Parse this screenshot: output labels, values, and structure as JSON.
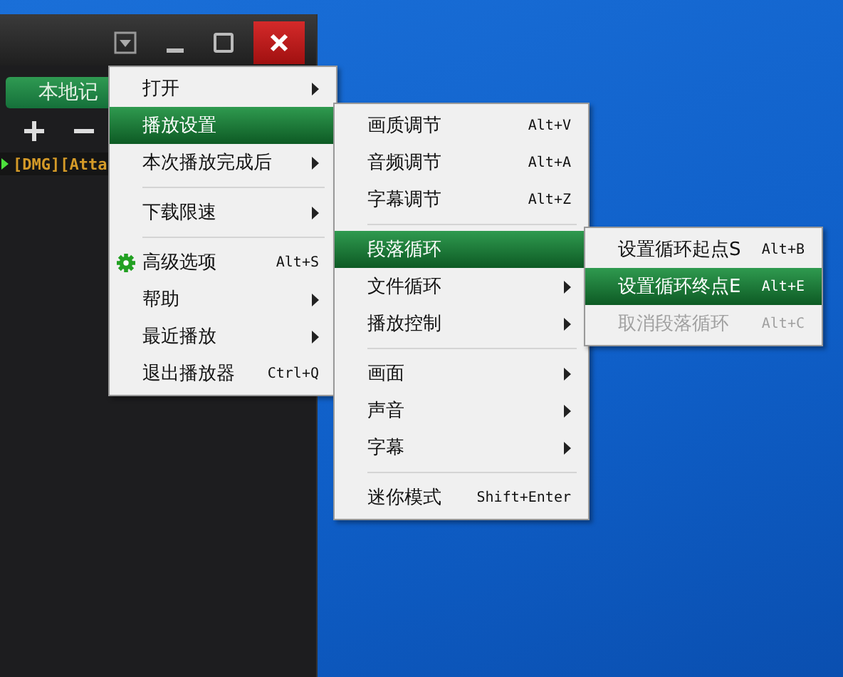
{
  "player": {
    "tab": {
      "label": "本地记",
      "selected": true
    },
    "playlist": [
      {
        "label": "[DMG][Atta",
        "playing": true
      }
    ]
  },
  "menus": [
    {
      "items": [
        {
          "kind": "item",
          "label": "打开",
          "submenu": true,
          "selected": false,
          "disabled": false
        },
        {
          "kind": "item",
          "label": "播放设置",
          "submenu": false,
          "selected": true,
          "disabled": false
        },
        {
          "kind": "item",
          "label": "本次播放完成后",
          "submenu": true,
          "selected": false,
          "disabled": false
        },
        {
          "kind": "separator"
        },
        {
          "kind": "item",
          "label": "下载限速",
          "submenu": true,
          "selected": false,
          "disabled": false
        },
        {
          "kind": "separator"
        },
        {
          "kind": "item",
          "label": "高级选项",
          "shortcut": "Alt+S",
          "icon": true,
          "submenu": false,
          "selected": false,
          "disabled": false
        },
        {
          "kind": "item",
          "label": "帮助",
          "submenu": true,
          "selected": false,
          "disabled": false
        },
        {
          "kind": "item",
          "label": "最近播放",
          "submenu": true,
          "selected": false,
          "disabled": false
        },
        {
          "kind": "item",
          "label": "退出播放器",
          "shortcut": "Ctrl+Q",
          "submenu": false,
          "selected": false,
          "disabled": false
        }
      ]
    },
    {
      "items": [
        {
          "kind": "item",
          "label": "画质调节",
          "shortcut": "Alt+V",
          "submenu": false,
          "selected": false,
          "disabled": false
        },
        {
          "kind": "item",
          "label": "音频调节",
          "shortcut": "Alt+A",
          "submenu": false,
          "selected": false,
          "disabled": false
        },
        {
          "kind": "item",
          "label": "字幕调节",
          "shortcut": "Alt+Z",
          "submenu": false,
          "selected": false,
          "disabled": false
        },
        {
          "kind": "separator"
        },
        {
          "kind": "item",
          "label": "段落循环",
          "submenu": false,
          "selected": true,
          "disabled": false
        },
        {
          "kind": "item",
          "label": "文件循环",
          "submenu": true,
          "selected": false,
          "disabled": false
        },
        {
          "kind": "item",
          "label": "播放控制",
          "submenu": true,
          "selected": false,
          "disabled": false
        },
        {
          "kind": "separator"
        },
        {
          "kind": "item",
          "label": "画面",
          "submenu": true,
          "selected": false,
          "disabled": false
        },
        {
          "kind": "item",
          "label": "声音",
          "submenu": true,
          "selected": false,
          "disabled": false
        },
        {
          "kind": "item",
          "label": "字幕",
          "submenu": true,
          "selected": false,
          "disabled": false
        },
        {
          "kind": "separator"
        },
        {
          "kind": "item",
          "label": "迷你模式",
          "shortcut": "Shift+Enter",
          "submenu": false,
          "selected": false,
          "disabled": false
        }
      ]
    },
    {
      "items": [
        {
          "kind": "item",
          "label": "设置循环起点S",
          "shortcut": "Alt+B",
          "submenu": false,
          "selected": false,
          "disabled": false
        },
        {
          "kind": "item",
          "label": "设置循环终点E",
          "shortcut": "Alt+E",
          "submenu": false,
          "selected": true,
          "disabled": false
        },
        {
          "kind": "item",
          "label": "取消段落循环",
          "shortcut": "Alt+C",
          "submenu": false,
          "selected": false,
          "disabled": true
        }
      ]
    }
  ]
}
